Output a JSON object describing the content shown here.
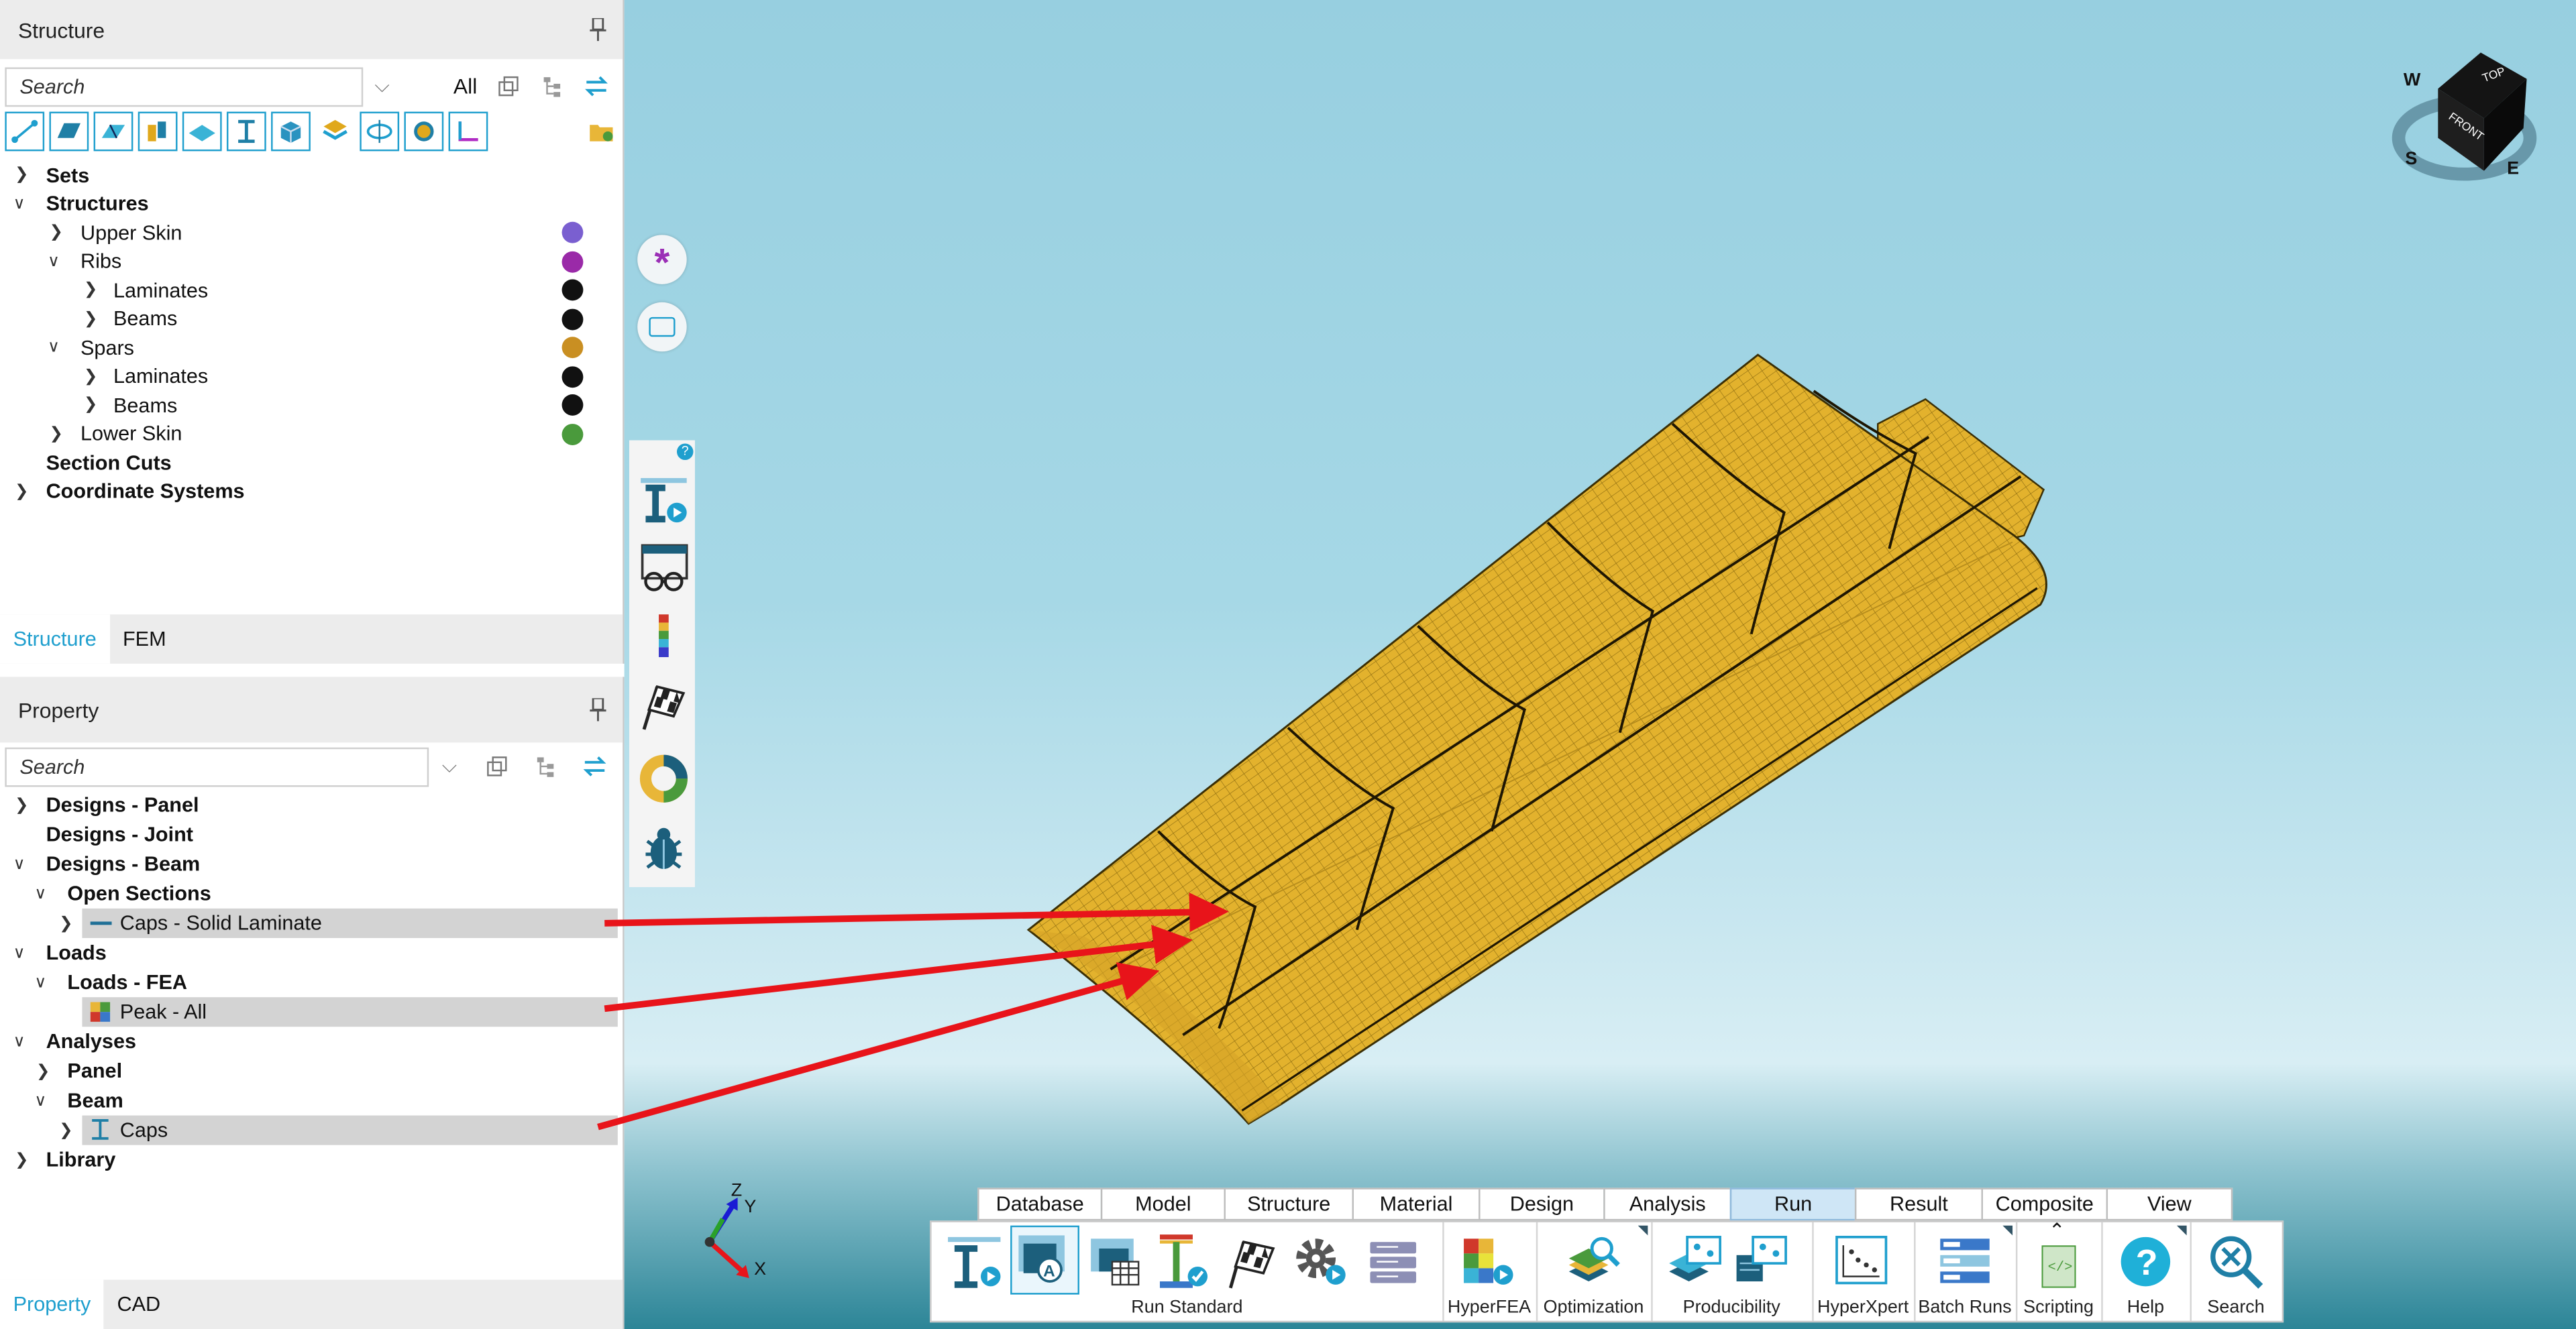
{
  "structure_panel": {
    "title": "Structure",
    "search_placeholder": "Search",
    "filter_label": "All",
    "tree": [
      {
        "label": "Sets",
        "bold": true
      },
      {
        "label": "Structures",
        "bold": true
      },
      {
        "label": "Upper Skin",
        "color": "#7a5fd0"
      },
      {
        "label": "Ribs",
        "color": "#9a2aa8"
      },
      {
        "label": "Laminates",
        "color": "#111111"
      },
      {
        "label": "Beams",
        "color": "#111111"
      },
      {
        "label": "Spars",
        "color": "#c98f22"
      },
      {
        "label": "Laminates",
        "color": "#111111"
      },
      {
        "label": "Beams",
        "color": "#111111"
      },
      {
        "label": "Lower Skin",
        "color": "#4a9a3c"
      },
      {
        "label": "Section Cuts",
        "bold": true
      },
      {
        "label": "Coordinate Systems",
        "bold": true
      }
    ],
    "tabs": [
      "Structure",
      "FEM"
    ]
  },
  "property_panel": {
    "title": "Property",
    "search_placeholder": "Search",
    "tree": [
      {
        "label": "Designs - Panel"
      },
      {
        "label": "Designs - Joint"
      },
      {
        "label": "Designs - Beam"
      },
      {
        "label": "Open Sections"
      },
      {
        "label": "Caps - Solid Laminate"
      },
      {
        "label": "Loads"
      },
      {
        "label": "Loads - FEA"
      },
      {
        "label": "Peak - All"
      },
      {
        "label": "Analyses"
      },
      {
        "label": "Panel"
      },
      {
        "label": "Beam"
      },
      {
        "label": "Caps"
      },
      {
        "label": "Library"
      }
    ],
    "tabs": [
      "Property",
      "CAD"
    ]
  },
  "viewcube": {
    "top": "TOP",
    "front": "FRONT",
    "compass": [
      "W",
      "S",
      "E"
    ]
  },
  "axes": {
    "x": "X",
    "y": "Y",
    "z": "Z"
  },
  "ribbon": {
    "tabs": [
      "Database",
      "Model",
      "Structure",
      "Material",
      "Design",
      "Analysis",
      "Run",
      "Result",
      "Composite",
      "View"
    ],
    "active_tab": "Run",
    "groups": [
      "Run Standard",
      "HyperFEA",
      "Optimization",
      "Producibility",
      "HyperXpert",
      "Batch Runs",
      "Scripting",
      "Help",
      "Search"
    ]
  },
  "colors": {
    "accent": "#1f9fce",
    "mesh_fill": "#e1b12c",
    "arrow": "#e8141a"
  }
}
